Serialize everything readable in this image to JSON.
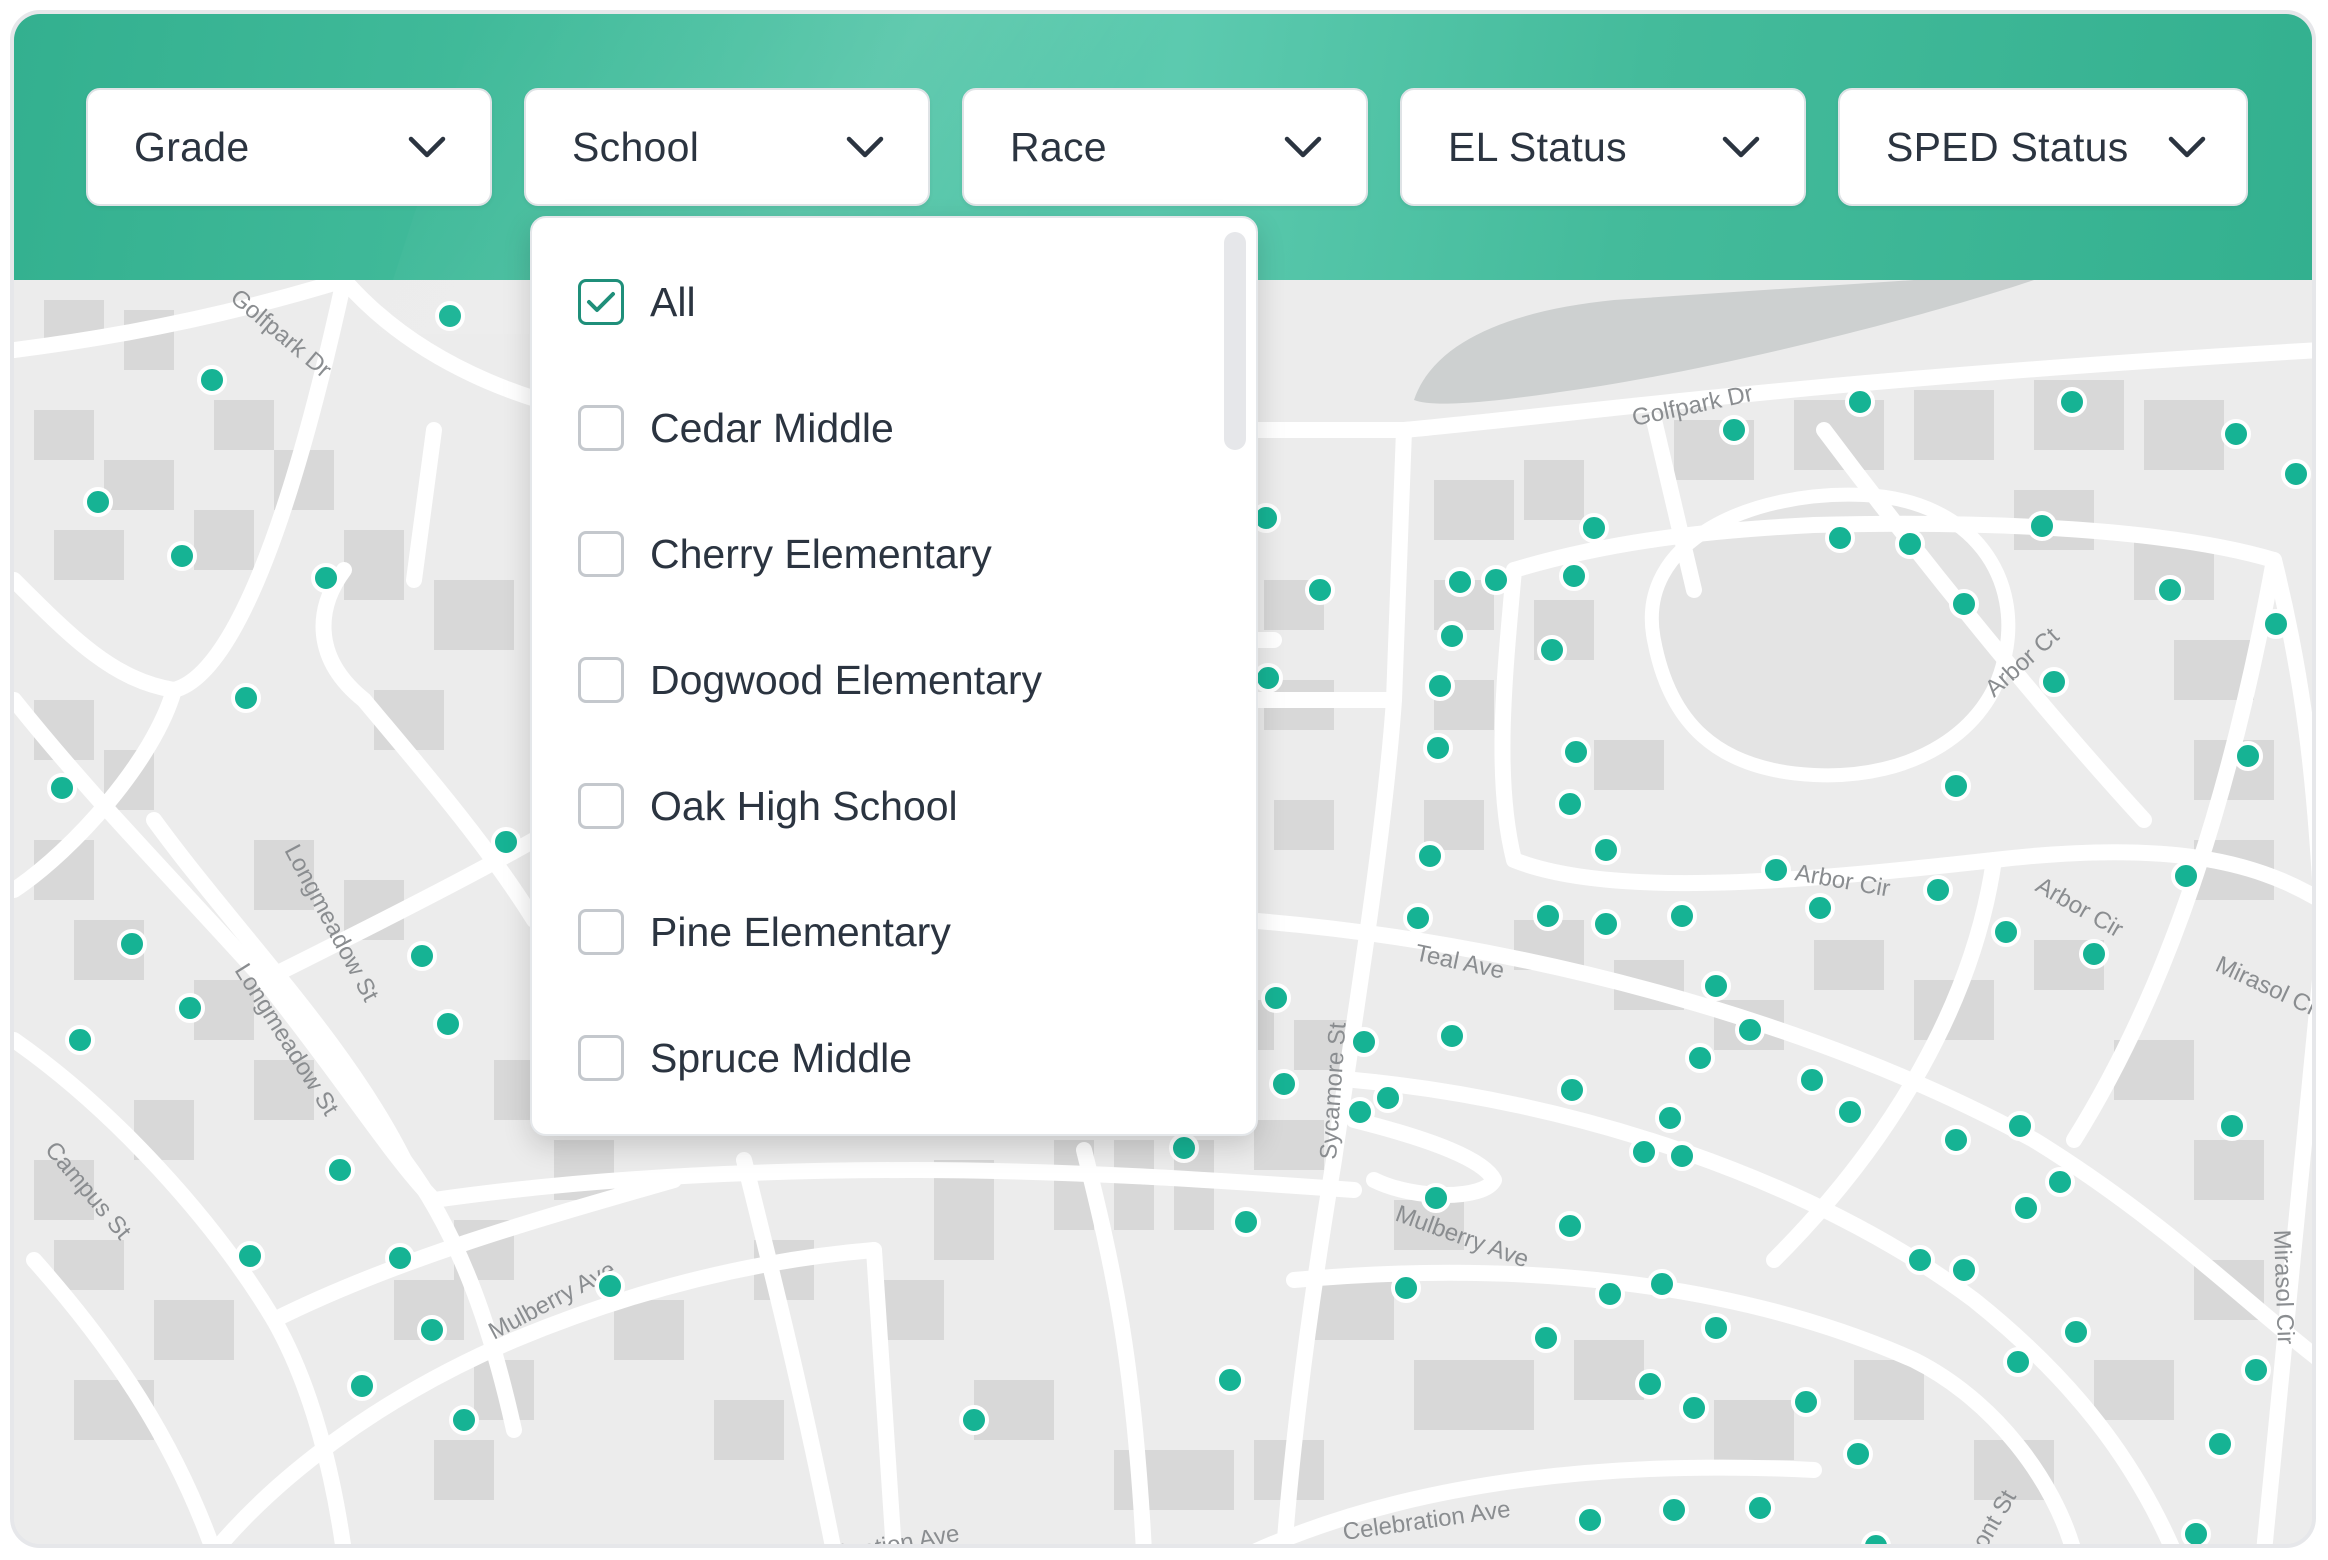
{
  "filters": [
    {
      "label": "Grade",
      "name": "grade-dropdown"
    },
    {
      "label": "School",
      "name": "school-dropdown"
    },
    {
      "label": "Race",
      "name": "race-dropdown"
    },
    {
      "label": "EL Status",
      "name": "el-status-dropdown"
    },
    {
      "label": "SPED Status",
      "name": "sped-status-dropdown"
    }
  ],
  "school_menu": {
    "options": [
      {
        "label": "All",
        "checked": true
      },
      {
        "label": "Cedar Middle",
        "checked": false
      },
      {
        "label": "Cherry Elementary",
        "checked": false
      },
      {
        "label": "Dogwood Elementary",
        "checked": false
      },
      {
        "label": "Oak High School",
        "checked": false
      },
      {
        "label": "Pine Elementary",
        "checked": false
      },
      {
        "label": "Spruce Middle",
        "checked": false
      }
    ]
  },
  "map": {
    "street_labels": [
      "Golfpark Dr",
      "Golfpark Dr",
      "Arbor Ct",
      "Arbor Cir",
      "Arbor Cir",
      "Mirasol Cir",
      "Mirasol Cir",
      "Teal Ave",
      "Sycamore St",
      "Mulberry Ave",
      "Mulberry Ave",
      "Longmeadow St",
      "Longmeadow St",
      "Campus St",
      "Celebration Ave",
      "Celebration Ave",
      "Front St"
    ],
    "marker_color": "#16b394",
    "marker_icon": "student-location-marker"
  },
  "colors": {
    "header_teal": "#3cb796",
    "map_background": "#ececec",
    "road": "#ffffff",
    "building": "#d8d8d8",
    "water": "#cdd0d0",
    "checkbox_accent": "#1f8f7a"
  }
}
